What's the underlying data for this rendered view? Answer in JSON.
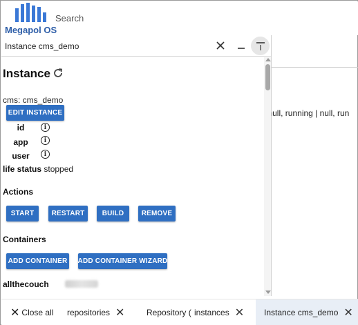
{
  "brand": {
    "name": "Megapol OS",
    "color": "#2e5ea8"
  },
  "search": {
    "placeholder": "Search"
  },
  "background": {
    "status_text": "g | null, running | null, run"
  },
  "panel": {
    "title": "Instance cms_demo",
    "header_icons": [
      "close-icon",
      "minimize-icon",
      "maximize-icon"
    ],
    "heading": "Instance",
    "cms_line": "cms: cms_demo",
    "edit_button": "EDIT INSTANCE",
    "fields": [
      {
        "label": "id",
        "icon": "info-icon"
      },
      {
        "label": "app",
        "icon": "info-icon"
      },
      {
        "label": "user",
        "icon": "info-icon"
      }
    ],
    "life_status": {
      "label": "life status",
      "value": "stopped"
    },
    "actions": {
      "title": "Actions",
      "buttons": [
        "START",
        "RESTART",
        "BUILD",
        "REMOVE"
      ]
    },
    "containers": {
      "title": "Containers",
      "buttons": [
        "ADD CONTAINER",
        "ADD CONTAINER WIZARD"
      ]
    },
    "container_name_prefix": "allthecouch"
  },
  "tabs": {
    "close_all": "Close all",
    "items": [
      {
        "label": "repositories",
        "active": false
      },
      {
        "label": "Repository (",
        "active": false
      },
      {
        "label": "instances",
        "active": false
      },
      {
        "label": "Instance cms_demo",
        "active": true
      }
    ]
  },
  "colors": {
    "button": "#2f6fc2",
    "active_tab": "#e8eef6"
  }
}
